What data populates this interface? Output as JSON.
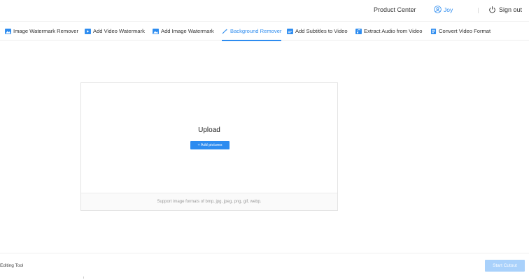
{
  "header": {
    "product_center": "Product Center",
    "user_name": "Joy",
    "sign_out": "Sign out"
  },
  "nav": {
    "tabs": [
      {
        "label": "Image Watermark Remover",
        "icon": "image-icon"
      },
      {
        "label": "Add Video Watermark",
        "icon": "video-icon"
      },
      {
        "label": "Add Image Watermark",
        "icon": "image-icon"
      },
      {
        "label": "Background Remover",
        "icon": "magic-wand-icon",
        "active": true
      },
      {
        "label": "Add Subtitles to Video",
        "icon": "subtitle-icon"
      },
      {
        "label": "Extract Audio from Video",
        "icon": "audio-icon"
      },
      {
        "label": "Convert Video Format",
        "icon": "convert-icon"
      }
    ]
  },
  "upload": {
    "title": "Upload",
    "add_button": "+ Add pictures",
    "support_text": "Support image formats of bmp, jpg, jpeg, png, gif, webp."
  },
  "footer": {
    "label": "Editing Tool",
    "start_button": "Start Cutout"
  },
  "colors": {
    "accent": "#2d8cf0",
    "disabled_button": "#a9d1fb"
  }
}
